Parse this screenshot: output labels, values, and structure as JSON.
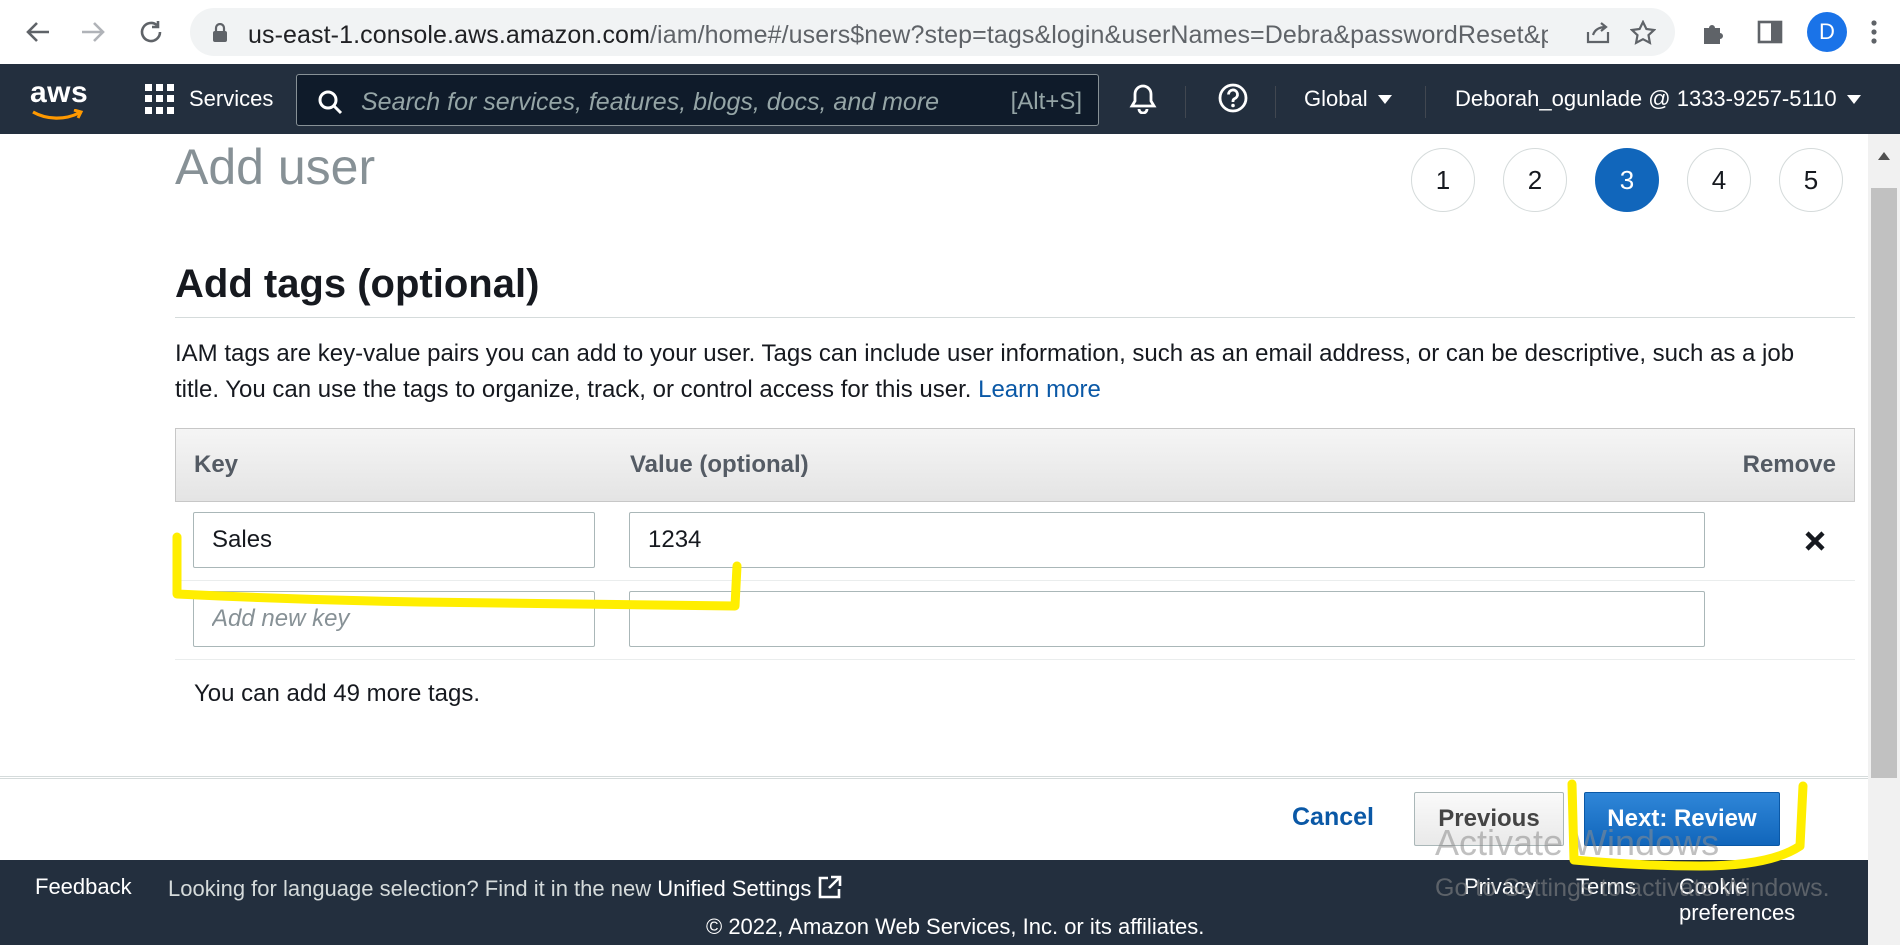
{
  "browser": {
    "url_host": "us-east-1.console.aws.amazon.com",
    "url_path": "/iam/home#/users$new?step=tags&login&userNames=Debra&passwordReset&pa...",
    "profile_initial": "D"
  },
  "aws_nav": {
    "logo_text": "aws",
    "services_label": "Services",
    "search_placeholder": "Search for services, features, blogs, docs, and more",
    "search_shortcut": "[Alt+S]",
    "region_label": "Global",
    "account_label": "Deborah_ogunlade @ 1333-9257-5110"
  },
  "page": {
    "title": "Add user",
    "steps": [
      "1",
      "2",
      "3",
      "4",
      "5"
    ],
    "active_step": "3"
  },
  "tags_section": {
    "title": "Add tags (optional)",
    "description": "IAM tags are key-value pairs you can add to your user. Tags can include user information, such as an email address, or can be descriptive, such as a job title. You can use the tags to organize, track, or control access for this user.",
    "learn_more": "Learn more",
    "columns": {
      "key": "Key",
      "value": "Value (optional)",
      "remove": "Remove"
    },
    "rows": [
      {
        "key": "Sales",
        "value": "1234"
      }
    ],
    "new_key_placeholder": "Add new key",
    "remaining_text": "You can add 49 more tags."
  },
  "actions": {
    "cancel": "Cancel",
    "previous": "Previous",
    "next": "Next: Review"
  },
  "footer": {
    "feedback": "Feedback",
    "language_prompt": "Looking for language selection? Find it in the new",
    "unified_settings": "Unified Settings",
    "privacy": "Privacy",
    "terms": "Terms",
    "cookies": "Cookie preferences",
    "copyright": "© 2022, Amazon Web Services, Inc. or its affiliates."
  },
  "watermark": {
    "title": "Activate Windows",
    "subtitle": "Go to Settings to activate Windows."
  },
  "colors": {
    "aws_nav": "#232f3e",
    "primary_button": "#1166bb",
    "link": "#0a58a6",
    "highlight": "#ffee00"
  }
}
